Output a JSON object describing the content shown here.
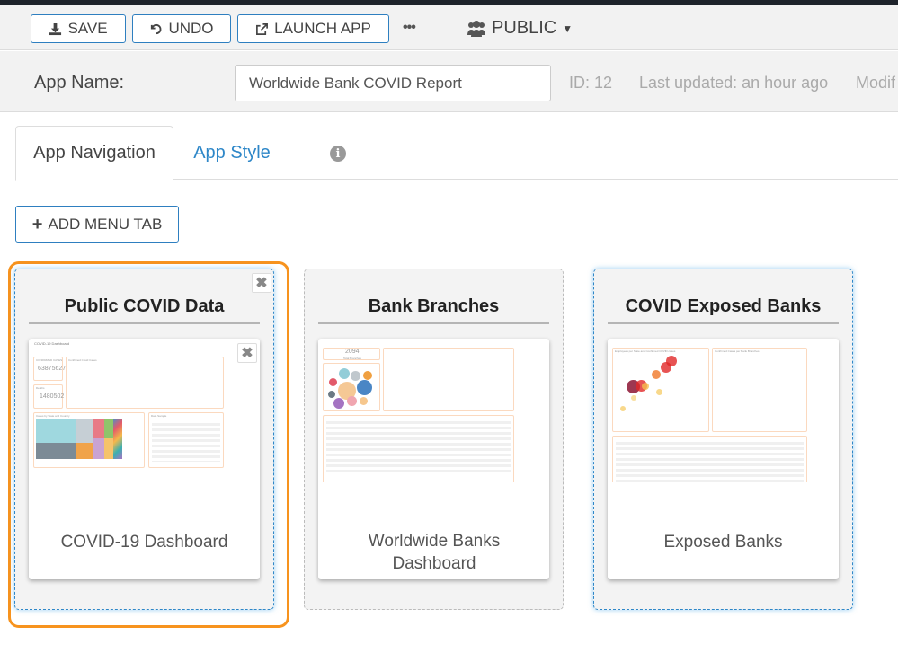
{
  "toolbar": {
    "save_label": "SAVE",
    "undo_label": "UNDO",
    "launch_label": "LAUNCH APP",
    "more_label": "•••",
    "visibility_label": "PUBLIC"
  },
  "infobar": {
    "app_name_label": "App Name:",
    "app_name_value": "Worldwide Bank COVID Report",
    "id_text": "ID: 12",
    "last_updated_text": "Last updated: an hour ago",
    "modified_text": "Modif"
  },
  "tabs": [
    {
      "label": "App Navigation",
      "active": true
    },
    {
      "label": "App Style",
      "active": false
    }
  ],
  "add_menu_tab_label": "ADD MENU TAB",
  "colors": {
    "accent_blue": "#2e7fc0",
    "selection_orange": "#f7931e",
    "link_blue": "#2e87c8"
  },
  "menu_tabs": [
    {
      "title": "Public COVID Data",
      "selected": true,
      "dashboard": {
        "label": "COVID-19 Dashboard",
        "thumb": {
          "heading": "COVID-19 Dashboard",
          "confirmed_label": "CONFIRMED CASES",
          "confirmed_value": "63875627",
          "deaths_label": "Deaths",
          "deaths_value": "1480502",
          "map_label": "Confirmed Covid Cases",
          "treemap_label": "Cases by State and Country",
          "table_label": "Data Sample"
        }
      }
    },
    {
      "title": "Bank Branches",
      "selected": false,
      "dashboard": {
        "label": "Worldwide Banks Dashboard",
        "thumb": {
          "kpi_value": "2094",
          "kpi_label": "Total Branches"
        }
      }
    },
    {
      "title": "COVID Exposed Banks",
      "selected": false,
      "dashboard": {
        "label": "Exposed Banks",
        "thumb": {
          "scatter_label": "Employees per State and Confirmed COVID cases",
          "map_label": "Confirmed Cases per Bank Branches"
        }
      }
    }
  ]
}
